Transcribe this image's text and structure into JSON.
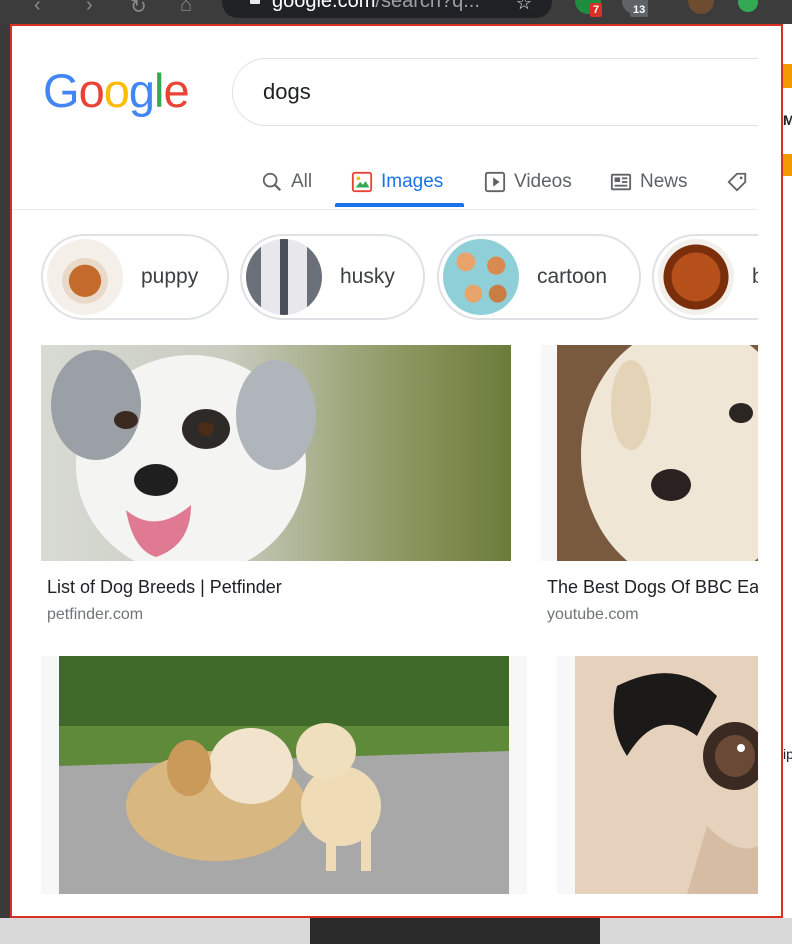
{
  "browser": {
    "url_main": "google.com",
    "url_rest": "/search?q...",
    "ext_badge_1": "7",
    "ext_badge_2": "13"
  },
  "logo": "Google",
  "search": {
    "value": "dogs"
  },
  "tabs": [
    {
      "label": "All",
      "icon": "search-icon"
    },
    {
      "label": "Images",
      "icon": "image-icon",
      "active": true
    },
    {
      "label": "Videos",
      "icon": "play-icon"
    },
    {
      "label": "News",
      "icon": "newspaper-icon"
    }
  ],
  "chips": [
    {
      "label": "puppy"
    },
    {
      "label": "husky"
    },
    {
      "label": "cartoon"
    },
    {
      "label": "b"
    }
  ],
  "results": [
    {
      "title": "List of Dog Breeds | Petfinder",
      "source": "petfinder.com"
    },
    {
      "title": "The Best Dogs Of BBC Ea",
      "source": "youtube.com"
    }
  ],
  "colors": {
    "accent": "#1a73e8",
    "frame": "#d93025"
  }
}
